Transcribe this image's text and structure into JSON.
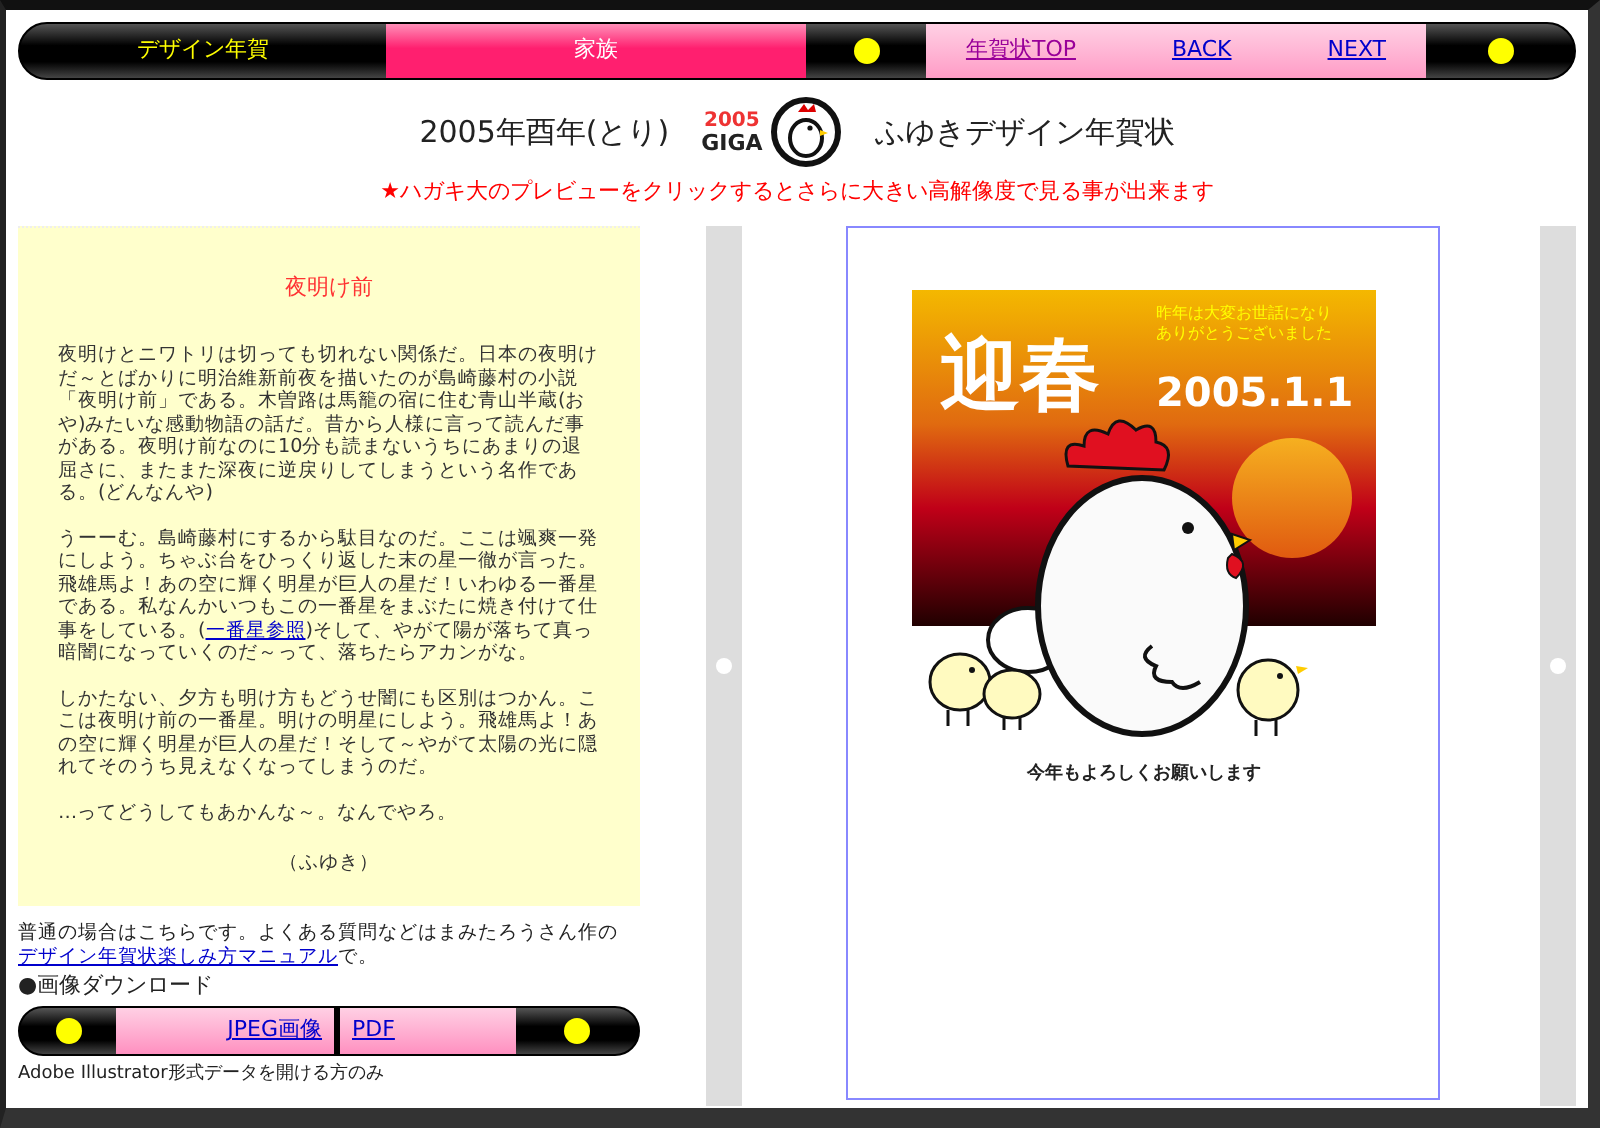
{
  "nav": {
    "items": [
      {
        "label": "デザイン年賀",
        "kind": "title"
      },
      {
        "label": "家族",
        "kind": "section"
      },
      {
        "label": "年賀状TOP",
        "kind": "link",
        "visited": true
      },
      {
        "label": "BACK",
        "kind": "link",
        "visited": false
      },
      {
        "label": "NEXT",
        "kind": "link",
        "visited": false
      }
    ]
  },
  "header": {
    "left": "2005年酉年(とり)",
    "logo_year": "2005",
    "logo_text": "GIGA",
    "right": "ふゆきデザイン年賀状"
  },
  "notice": "★ハガキ大のプレビューをクリックするとさらに大きい高解像度で見る事が出来ます",
  "essay": {
    "title": "夜明け前",
    "paragraphs": [
      [
        {
          "text": "夜明けとニワトリは切っても切れない関係だ。日本の夜明けだ～とばかりに明治維新前夜を描いたのが島崎藤村の小説「夜明け前」である。木曽路は馬籠の宿に住む青山半蔵(おや)みたいな感動物語の話だ。昔から人様に言って読んだ事がある。夜明け前なのに10分も読まないうちにあまりの退屈さに、またまた深夜に逆戻りしてしまうという名作である。(どんなんや)",
          "link": false
        }
      ],
      [
        {
          "text": "うーーむ。島崎藤村にするから駄目なのだ。ここは颯爽一発にしよう。ちゃぶ台をひっくり返した末の星一徹が言った。飛雄馬よ！あの空に輝く明星が巨人の星だ！いわゆる一番星である。私なんかいつもこの一番星をまぶたに焼き付けて仕事をしている。(",
          "link": false
        },
        {
          "text": "一番星参照",
          "link": true
        },
        {
          "text": ")そして、やがて陽が落ちて真っ暗闇になっていくのだ～って、落ちたらアカンがな。",
          "link": false
        }
      ],
      [
        {
          "text": "しかたない、夕方も明け方もどうせ闇にも区別はつかん。ここは夜明け前の一番星。明けの明星にしよう。飛雄馬よ！あの空に輝く明星が巨人の星だ！そして～やがて太陽の光に隠れてそのうち見えなくなってしまうのだ。",
          "link": false
        }
      ],
      [
        {
          "text": "…ってどうしてもあかんな～。なんでやろ。",
          "link": false
        }
      ]
    ],
    "signature": "（ふゆき）"
  },
  "note": [
    {
      "text": "普通の場合はこちらです。よくある質問などはまみたろうさん作の",
      "link": false
    },
    {
      "text": "デザイン年賀状楽しみ方マニュアル",
      "link": true
    },
    {
      "text": "で。",
      "link": false
    }
  ],
  "download": {
    "heading": "●画像ダウンロード",
    "buttons": [
      "JPEG画像",
      "PDF"
    ],
    "note": "Adobe Illustrator形式データを開ける方のみ"
  },
  "card": {
    "greeting": "迎春",
    "message": [
      "昨年は大変お世話になり",
      "ありがとうございました"
    ],
    "date": "2005.1.1",
    "closing": "今年もよろしくお願いします"
  }
}
